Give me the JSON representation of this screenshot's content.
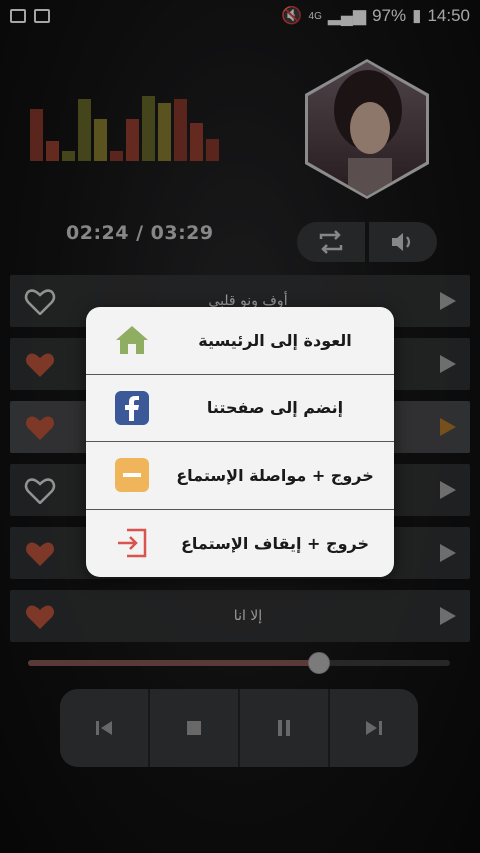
{
  "status_bar": {
    "battery": "97%",
    "time": "14:50",
    "network": "4G"
  },
  "player": {
    "time_display": "02:24 / 03:29",
    "progress": 0.69,
    "visualizer": [
      {
        "h": 52,
        "c": "#8a3a2c"
      },
      {
        "h": 20,
        "c": "#9a4030"
      },
      {
        "h": 10,
        "c": "#6a6a2a"
      },
      {
        "h": 62,
        "c": "#6a6a2a"
      },
      {
        "h": 42,
        "c": "#8a8030"
      },
      {
        "h": 10,
        "c": "#8a3a2c"
      },
      {
        "h": 42,
        "c": "#9a4030"
      },
      {
        "h": 65,
        "c": "#6a6a2a"
      },
      {
        "h": 58,
        "c": "#8a8030"
      },
      {
        "h": 62,
        "c": "#8a3a2c"
      },
      {
        "h": 38,
        "c": "#9a4030"
      },
      {
        "h": 22,
        "c": "#8a3a2c"
      }
    ]
  },
  "tracks": [
    {
      "title": "أوف ونو قلبي",
      "liked": false,
      "active": false
    },
    {
      "title": "",
      "liked": true,
      "active": false
    },
    {
      "title": "",
      "liked": true,
      "active": true
    },
    {
      "title": "",
      "liked": false,
      "active": false
    },
    {
      "title": "",
      "liked": true,
      "active": false
    },
    {
      "title": "إلا انا",
      "liked": true,
      "active": false
    }
  ],
  "menu": {
    "items": [
      {
        "label": "العودة إلى الرئيسية",
        "icon": "home-icon"
      },
      {
        "label": "إنضم إلى صفحتنا",
        "icon": "facebook-icon"
      },
      {
        "label": "خروج + مواصلة الإستماع",
        "icon": "minimize-icon"
      },
      {
        "label": "خروج + إيقاف الإستماع",
        "icon": "exit-icon"
      }
    ]
  },
  "colors": {
    "heart_fill": "#c0563c",
    "accent": "#b67a2c"
  }
}
